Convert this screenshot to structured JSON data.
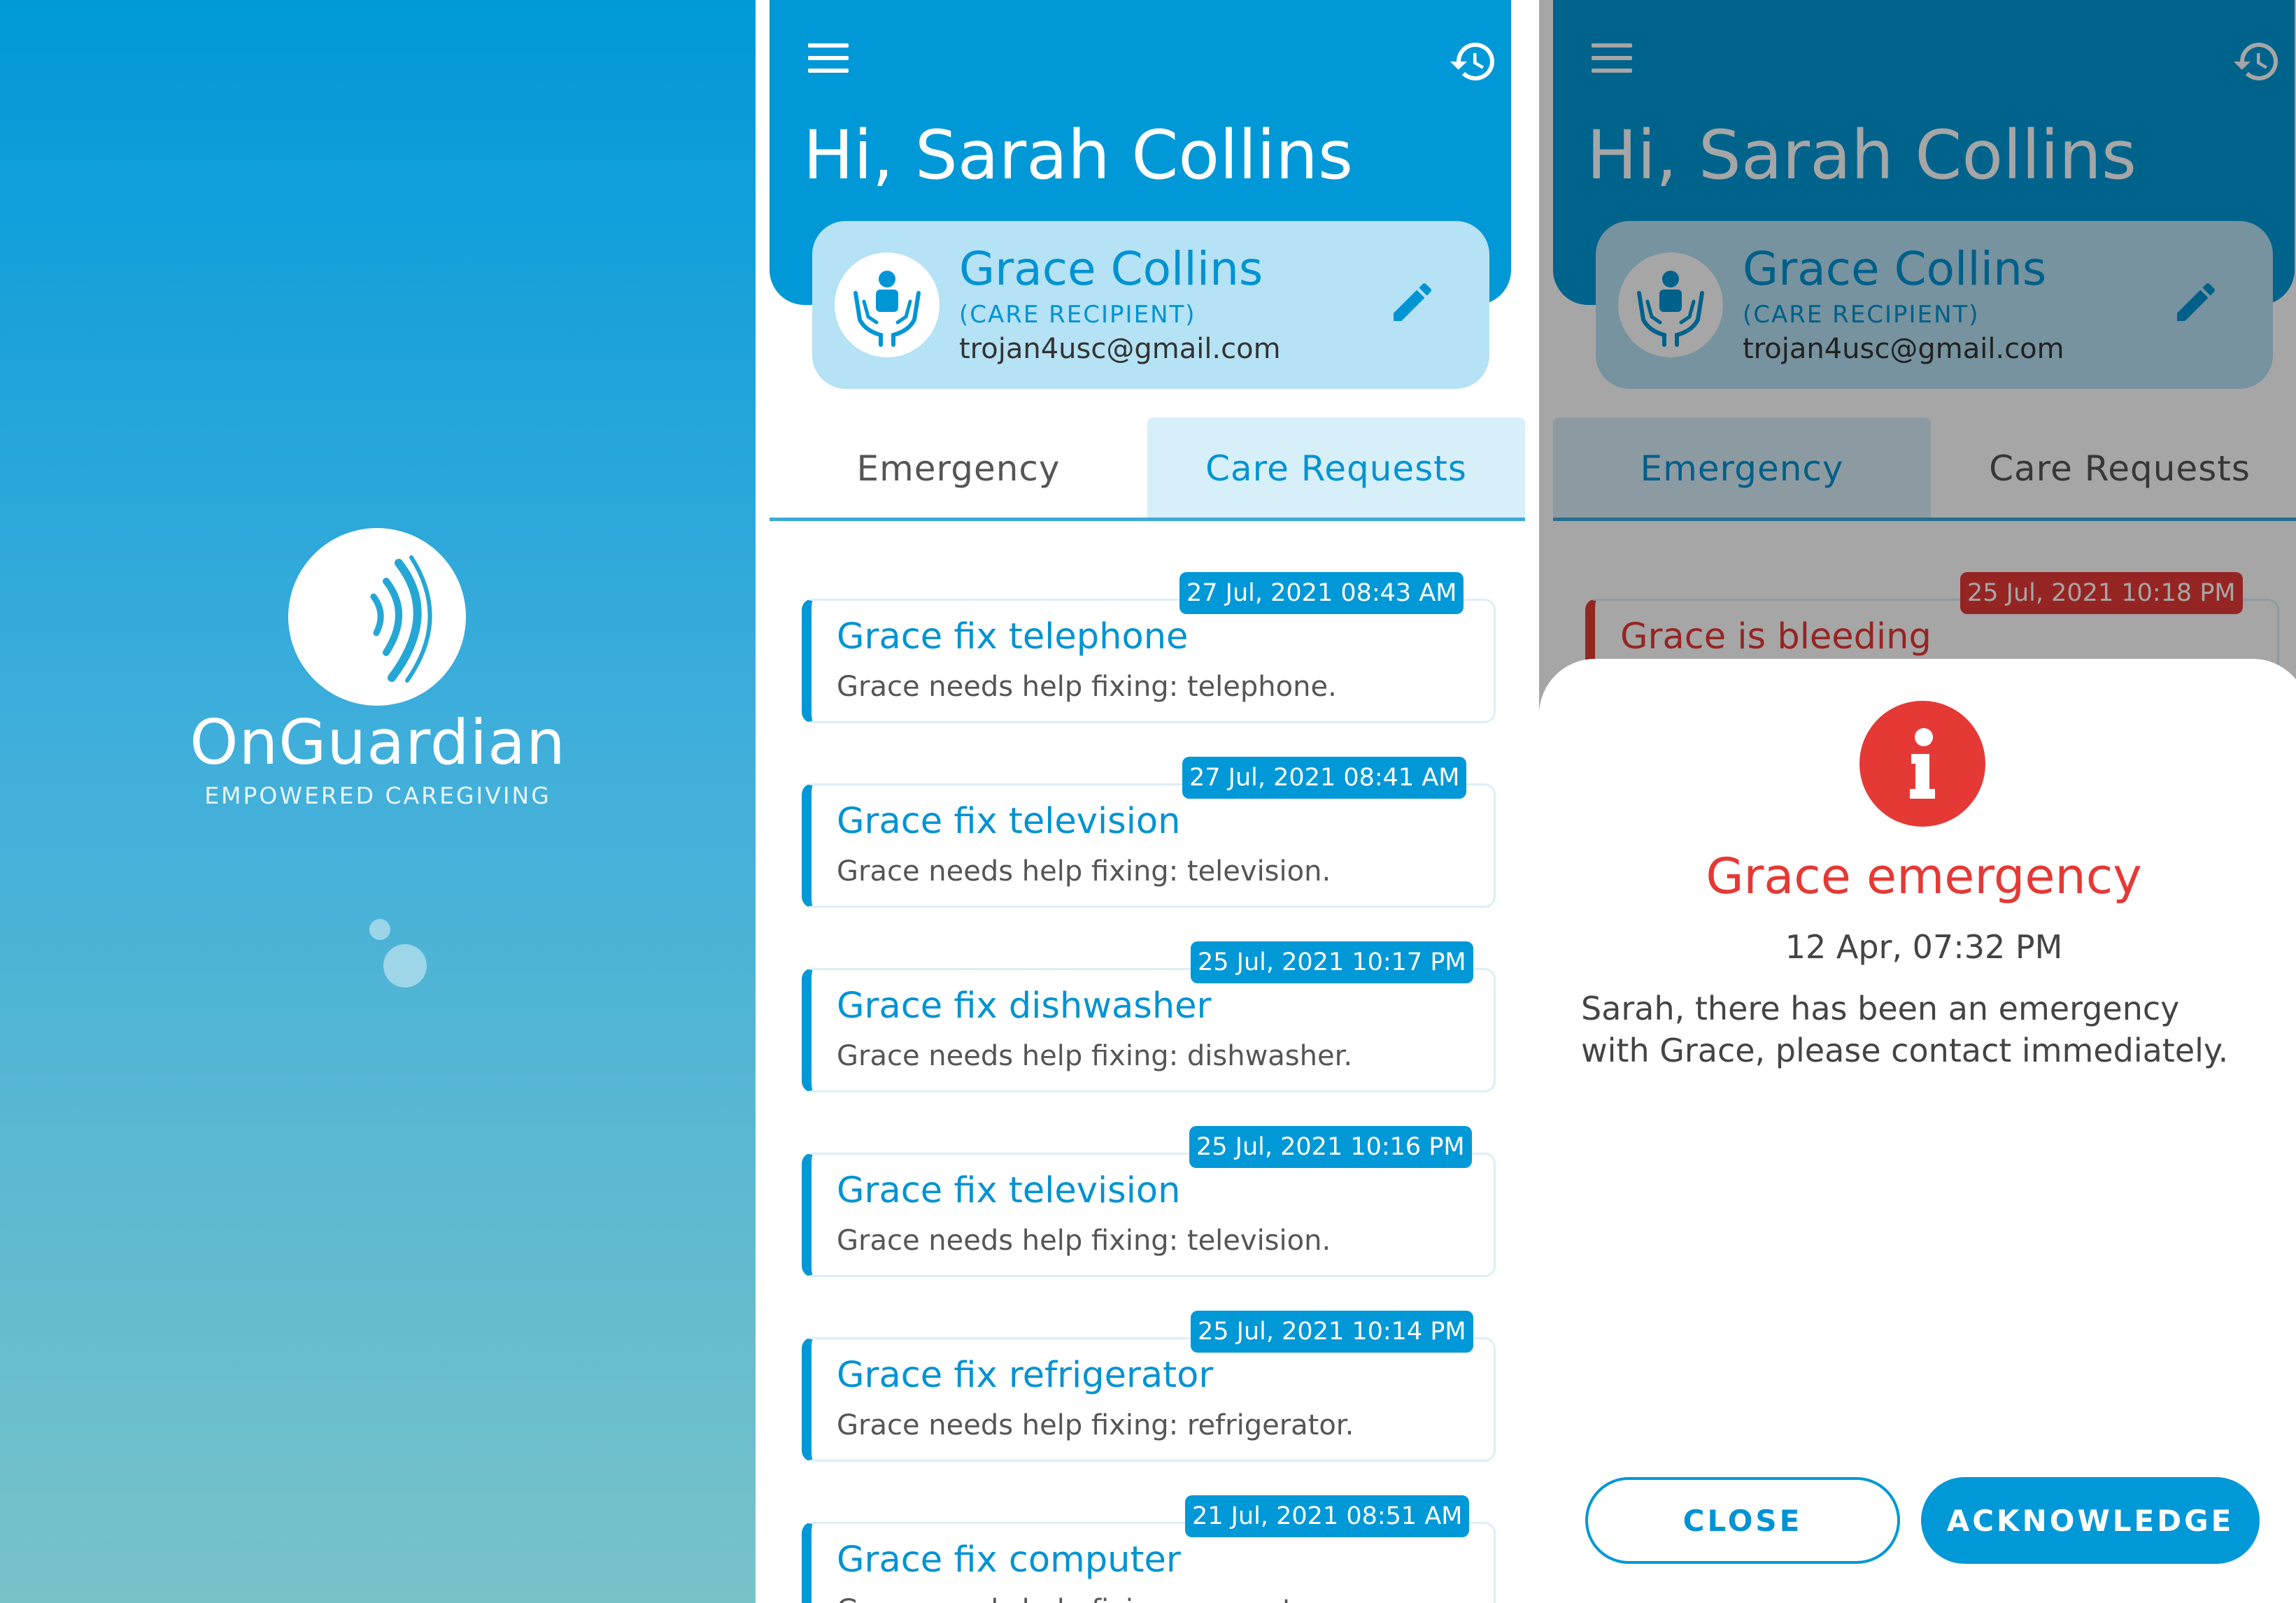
{
  "splash": {
    "brand_name": "OnGuardian",
    "tagline": "EMPOWERED CAREGIVING",
    "background_top": "#0099d8",
    "background_bottom": "#78c3c8"
  },
  "app": {
    "greeting": "Hi, Sarah Collins",
    "icons": {
      "menu": "menu-icon",
      "history": "history-icon",
      "edit": "edit-pencil-icon",
      "avatar": "care-hands-icon",
      "alert": "info-alert-icon"
    },
    "accent_color": "#0098d7",
    "profile": {
      "name": "Grace Collins",
      "role": "(CARE RECIPIENT)",
      "email": "trojan4usc@gmail.com"
    },
    "tabs": [
      "Emergency",
      "Care Requests"
    ]
  },
  "care_requests": [
    {
      "time": "27 Jul, 2021 08:43 AM",
      "title": "Grace fix telephone",
      "description": "Grace needs help fixing: telephone."
    },
    {
      "time": "27 Jul, 2021 08:41 AM",
      "title": "Grace fix television",
      "description": "Grace needs help fixing: television."
    },
    {
      "time": "25 Jul, 2021 10:17 PM",
      "title": "Grace fix dishwasher",
      "description": "Grace needs help fixing: dishwasher."
    },
    {
      "time": "25 Jul, 2021 10:16 PM",
      "title": "Grace fix television",
      "description": "Grace needs help fixing: television."
    },
    {
      "time": "25 Jul, 2021 10:14 PM",
      "title": "Grace fix refrigerator",
      "description": "Grace needs help fixing: refrigerator."
    },
    {
      "time": "21 Jul, 2021 08:51 AM",
      "title": "Grace fix computer",
      "description": "Grace needs help fixing: computer."
    }
  ],
  "emergency_list": [
    {
      "time": "25 Jul, 2021 10:18 PM",
      "title": "Grace is bleeding"
    }
  ],
  "emergency_dialog": {
    "title": "Grace emergency",
    "time": "12 Apr, 07:32 PM",
    "message": "Sarah, there has been an emergency with Grace, please contact immediately.",
    "close_label": "CLOSE",
    "acknowledge_label": "ACKNOWLEDGE",
    "alert_color": "#e53935"
  }
}
